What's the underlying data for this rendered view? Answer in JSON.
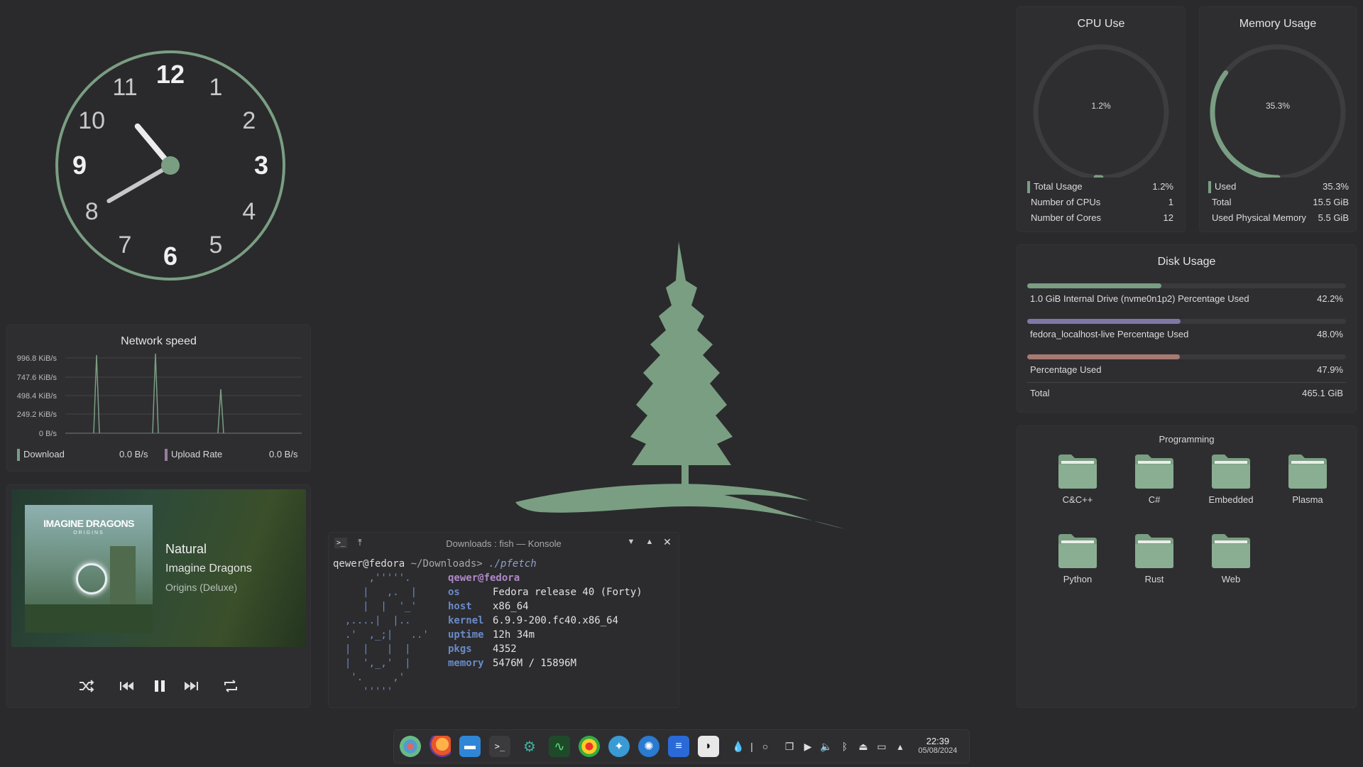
{
  "clock": {
    "numbers": [
      "12",
      "1",
      "2",
      "3",
      "4",
      "5",
      "6",
      "7",
      "8",
      "9",
      "10",
      "11"
    ],
    "time_hour": 10,
    "time_minute": 40
  },
  "network": {
    "title": "Network speed",
    "y_ticks": [
      "996.8 KiB/s",
      "747.6 KiB/s",
      "498.4 KiB/s",
      "249.2 KiB/s",
      "0 B/s"
    ],
    "download_label": "Download",
    "download_value": "0.0 B/s",
    "upload_label": "Upload Rate",
    "upload_value": "0.0 B/s",
    "colors": {
      "download": "#7a9e82",
      "upload": "#9a7aa0"
    }
  },
  "media": {
    "album_art_text": "IMAGINE DRAGONS",
    "album_art_subtext": "ORIGINS",
    "track": "Natural",
    "artist": "Imagine Dragons",
    "album": "Origins (Deluxe)"
  },
  "cpu": {
    "title": "CPU Use",
    "gauge_label": "1.2%",
    "gauge_fraction": 0.012,
    "rows": [
      {
        "label": "Total Usage",
        "value": "1.2%"
      },
      {
        "label": "Number of CPUs",
        "value": "1"
      },
      {
        "label": "Number of Cores",
        "value": "12"
      }
    ]
  },
  "memory": {
    "title": "Memory Usage",
    "gauge_label": "35.3%",
    "gauge_fraction": 0.353,
    "rows": [
      {
        "label": "Used",
        "value": "35.3%"
      },
      {
        "label": "Total",
        "value": "15.5 GiB"
      },
      {
        "label": "Used Physical Memory",
        "value": "5.5 GiB"
      }
    ]
  },
  "disk": {
    "title": "Disk Usage",
    "items": [
      {
        "label": "1.0 GiB Internal Drive (nvme0n1p2) Percentage Used",
        "value": "42.2%",
        "fraction": 0.422,
        "color": "#7a9e82"
      },
      {
        "label": "fedora_localhost-live Percentage Used",
        "value": "48.0%",
        "fraction": 0.48,
        "color": "#7f78a6"
      },
      {
        "label": "Percentage Used",
        "value": "47.9%",
        "fraction": 0.479,
        "color": "#a67a72"
      }
    ],
    "total_label": "Total",
    "total_value": "465.1 GiB"
  },
  "folders": {
    "title": "Programming",
    "items": [
      "C&C++",
      "C#",
      "Embedded",
      "Plasma",
      "Python",
      "Rust",
      "Web"
    ]
  },
  "konsole": {
    "title": "Downloads : fish — Konsole",
    "prompt_user": "qewer@fedora",
    "prompt_path": "~/Downloads>",
    "prompt_cmd": "./pfetch",
    "user_host": "qewer@fedora",
    "info": [
      {
        "key": "os",
        "value": "Fedora release 40 (Forty)"
      },
      {
        "key": "host",
        "value": "x86_64"
      },
      {
        "key": "kernel",
        "value": "6.9.9-200.fc40.x86_64"
      },
      {
        "key": "uptime",
        "value": "12h 34m"
      },
      {
        "key": "pkgs",
        "value": "4352"
      },
      {
        "key": "memory",
        "value": "5476M / 15896M"
      }
    ],
    "logo_lines": [
      "      ,'''''.",
      "     |   ,.  |",
      "     |  |  '_'",
      "  ,....|  |..",
      "  .'  ,_;|   ..'",
      "  |  |   |  |",
      "  |  ',_,'  |",
      "   '.     ,'",
      "     '''''"
    ]
  },
  "taskbar": {
    "time": "22:39",
    "date": "05/08/2024"
  },
  "accent": "#7a9e82"
}
